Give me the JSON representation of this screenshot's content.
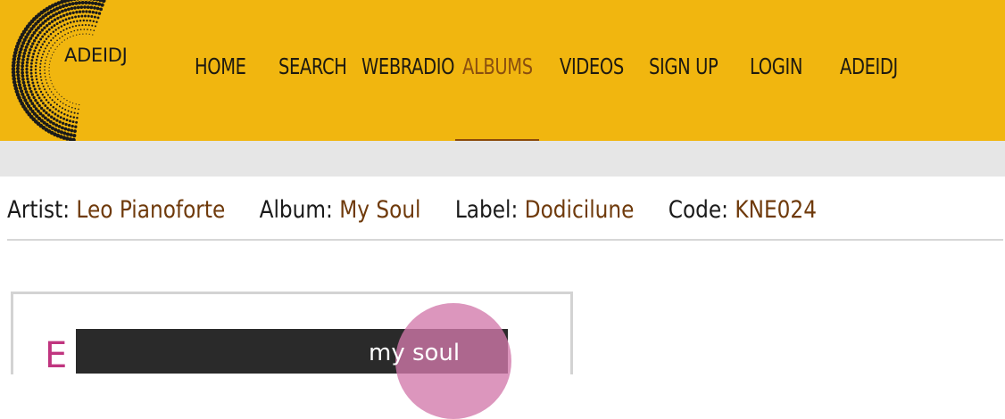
{
  "logo": {
    "text": "ADEIDJ"
  },
  "nav": {
    "items": [
      {
        "label": "HOME",
        "active": false
      },
      {
        "label": "SEARCH",
        "active": false
      },
      {
        "label": "WEBRADIO",
        "active": false
      },
      {
        "label": "ALBUMS",
        "active": true
      },
      {
        "label": "VIDEOS",
        "active": false
      },
      {
        "label": "SIGN UP",
        "active": false
      },
      {
        "label": "LOGIN",
        "active": false
      },
      {
        "label": "ADEIDJ",
        "active": false
      }
    ]
  },
  "album_info": {
    "artist_label": "Artist:",
    "artist": "Leo Pianoforte",
    "album_label": "Album:",
    "album": "My Soul",
    "label_label": "Label:",
    "label": "Dodicilune",
    "code_label": "Code:",
    "code": "KNE024"
  },
  "cover": {
    "text": "my soul"
  },
  "colors": {
    "header": "#f1b60f",
    "active_nav": "#8a4f0f",
    "meta_value": "#6f3a0b",
    "band": "#e6e6e6"
  }
}
